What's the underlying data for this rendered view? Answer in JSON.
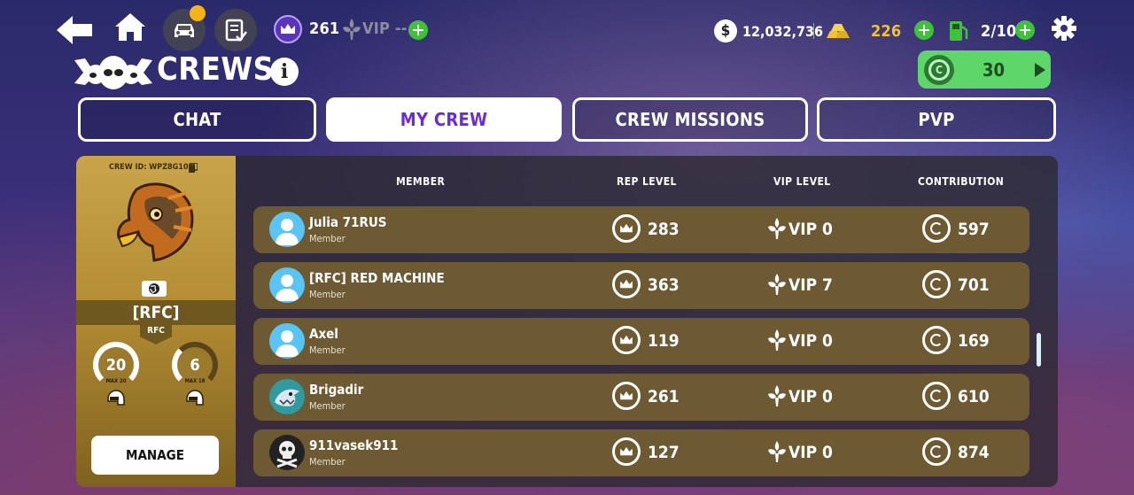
{
  "topbar": {
    "crown_count": "261",
    "vip_label": "VIP --",
    "cash": "12,032,736",
    "gold": "226",
    "fuel": "2/10"
  },
  "header": {
    "title": "CREWS",
    "token_count": "30"
  },
  "tabs": [
    {
      "label": "CHAT",
      "active": false
    },
    {
      "label": "MY CREW",
      "active": true
    },
    {
      "label": "CREW MISSIONS",
      "active": false
    },
    {
      "label": "PVP",
      "active": false
    }
  ],
  "crew": {
    "id_label": "CREW ID: WPZ8G10M",
    "tag": "[RFC]",
    "short": "RFC",
    "members_value": "20",
    "members_max": "MAX 20",
    "second_value": "6",
    "second_max": "MAX 18",
    "manage_label": "MANAGE"
  },
  "table": {
    "headers": [
      "MEMBER",
      "REP LEVEL",
      "VIP LEVEL",
      "CONTRIBUTION"
    ],
    "rows": [
      {
        "name": "Julia 71RUS",
        "role": "Member",
        "rep": "283",
        "vip": "VIP 0",
        "contribution": "597",
        "avatar": "default"
      },
      {
        "name": "[RFC] RED MACHINE",
        "role": "Member",
        "rep": "363",
        "vip": "VIP 7",
        "contribution": "701",
        "avatar": "default"
      },
      {
        "name": "Axel",
        "role": "Member",
        "rep": "119",
        "vip": "VIP 0",
        "contribution": "169",
        "avatar": "default"
      },
      {
        "name": "Brigadir",
        "role": "Member",
        "rep": "261",
        "vip": "VIP 0",
        "contribution": "610",
        "avatar": "shark"
      },
      {
        "name": "911vasek911",
        "role": "Member",
        "rep": "127",
        "vip": "VIP 0",
        "contribution": "874",
        "avatar": "skull"
      }
    ]
  },
  "colors": {
    "accent_purple": "#6a2bd9",
    "plus_green": "#3fc23a",
    "token_green": "#5ed66a",
    "gold_text": "#f2c230",
    "row_brown": "#6d5a32"
  }
}
